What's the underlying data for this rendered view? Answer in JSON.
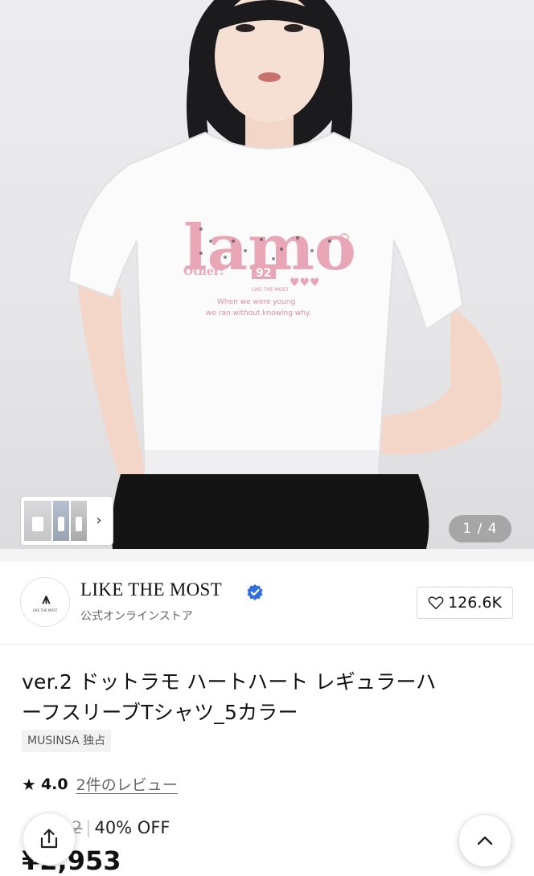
{
  "gallery": {
    "counter": "1 / 4",
    "thumb_arrow": "›",
    "shirt_print": {
      "logo": "lamo",
      "other_label": "Other:",
      "number": "92",
      "brand_line": "LIKE THE MOST",
      "line1": "When we were young",
      "line2": "we ran without knowing why."
    }
  },
  "brand": {
    "logo_mark": "⩚",
    "logo_small": "LIKE THE MOST",
    "name": "LIKE THE MOST",
    "subtitle": "公式オンラインストア",
    "likes": "126.6K"
  },
  "product": {
    "title_line1": "ver.2 ドットラモ ハートハート レギュラーハ",
    "title_line2": "ーフスリーブTシャツ_5カラー",
    "badge": "MUSINSA 独占",
    "rating": "4.0",
    "reviews": "2件のレビュー",
    "original_price": "2",
    "discount": "40% OFF",
    "final_price": "¥2,953"
  },
  "colors": {
    "accent_blue": "#2f6fe0",
    "print_pink": "#e8a6b7"
  }
}
